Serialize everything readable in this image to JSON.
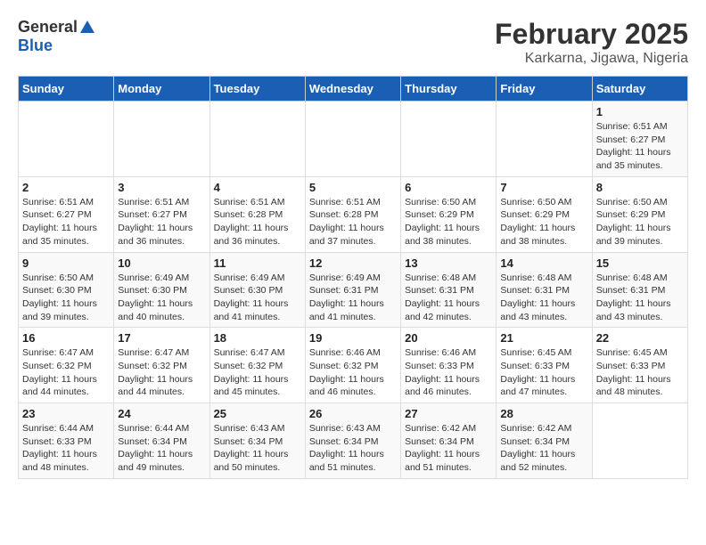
{
  "header": {
    "logo_general": "General",
    "logo_blue": "Blue",
    "title": "February 2025",
    "subtitle": "Karkarna, Jigawa, Nigeria"
  },
  "days_of_week": [
    "Sunday",
    "Monday",
    "Tuesday",
    "Wednesday",
    "Thursday",
    "Friday",
    "Saturday"
  ],
  "weeks": [
    [
      {
        "day": "",
        "info": ""
      },
      {
        "day": "",
        "info": ""
      },
      {
        "day": "",
        "info": ""
      },
      {
        "day": "",
        "info": ""
      },
      {
        "day": "",
        "info": ""
      },
      {
        "day": "",
        "info": ""
      },
      {
        "day": "1",
        "info": "Sunrise: 6:51 AM\nSunset: 6:27 PM\nDaylight: 11 hours\nand 35 minutes."
      }
    ],
    [
      {
        "day": "2",
        "info": "Sunrise: 6:51 AM\nSunset: 6:27 PM\nDaylight: 11 hours\nand 35 minutes."
      },
      {
        "day": "3",
        "info": "Sunrise: 6:51 AM\nSunset: 6:27 PM\nDaylight: 11 hours\nand 36 minutes."
      },
      {
        "day": "4",
        "info": "Sunrise: 6:51 AM\nSunset: 6:28 PM\nDaylight: 11 hours\nand 36 minutes."
      },
      {
        "day": "5",
        "info": "Sunrise: 6:51 AM\nSunset: 6:28 PM\nDaylight: 11 hours\nand 37 minutes."
      },
      {
        "day": "6",
        "info": "Sunrise: 6:50 AM\nSunset: 6:29 PM\nDaylight: 11 hours\nand 38 minutes."
      },
      {
        "day": "7",
        "info": "Sunrise: 6:50 AM\nSunset: 6:29 PM\nDaylight: 11 hours\nand 38 minutes."
      },
      {
        "day": "8",
        "info": "Sunrise: 6:50 AM\nSunset: 6:29 PM\nDaylight: 11 hours\nand 39 minutes."
      }
    ],
    [
      {
        "day": "9",
        "info": "Sunrise: 6:50 AM\nSunset: 6:30 PM\nDaylight: 11 hours\nand 39 minutes."
      },
      {
        "day": "10",
        "info": "Sunrise: 6:49 AM\nSunset: 6:30 PM\nDaylight: 11 hours\nand 40 minutes."
      },
      {
        "day": "11",
        "info": "Sunrise: 6:49 AM\nSunset: 6:30 PM\nDaylight: 11 hours\nand 41 minutes."
      },
      {
        "day": "12",
        "info": "Sunrise: 6:49 AM\nSunset: 6:31 PM\nDaylight: 11 hours\nand 41 minutes."
      },
      {
        "day": "13",
        "info": "Sunrise: 6:48 AM\nSunset: 6:31 PM\nDaylight: 11 hours\nand 42 minutes."
      },
      {
        "day": "14",
        "info": "Sunrise: 6:48 AM\nSunset: 6:31 PM\nDaylight: 11 hours\nand 43 minutes."
      },
      {
        "day": "15",
        "info": "Sunrise: 6:48 AM\nSunset: 6:31 PM\nDaylight: 11 hours\nand 43 minutes."
      }
    ],
    [
      {
        "day": "16",
        "info": "Sunrise: 6:47 AM\nSunset: 6:32 PM\nDaylight: 11 hours\nand 44 minutes."
      },
      {
        "day": "17",
        "info": "Sunrise: 6:47 AM\nSunset: 6:32 PM\nDaylight: 11 hours\nand 44 minutes."
      },
      {
        "day": "18",
        "info": "Sunrise: 6:47 AM\nSunset: 6:32 PM\nDaylight: 11 hours\nand 45 minutes."
      },
      {
        "day": "19",
        "info": "Sunrise: 6:46 AM\nSunset: 6:32 PM\nDaylight: 11 hours\nand 46 minutes."
      },
      {
        "day": "20",
        "info": "Sunrise: 6:46 AM\nSunset: 6:33 PM\nDaylight: 11 hours\nand 46 minutes."
      },
      {
        "day": "21",
        "info": "Sunrise: 6:45 AM\nSunset: 6:33 PM\nDaylight: 11 hours\nand 47 minutes."
      },
      {
        "day": "22",
        "info": "Sunrise: 6:45 AM\nSunset: 6:33 PM\nDaylight: 11 hours\nand 48 minutes."
      }
    ],
    [
      {
        "day": "23",
        "info": "Sunrise: 6:44 AM\nSunset: 6:33 PM\nDaylight: 11 hours\nand 48 minutes."
      },
      {
        "day": "24",
        "info": "Sunrise: 6:44 AM\nSunset: 6:34 PM\nDaylight: 11 hours\nand 49 minutes."
      },
      {
        "day": "25",
        "info": "Sunrise: 6:43 AM\nSunset: 6:34 PM\nDaylight: 11 hours\nand 50 minutes."
      },
      {
        "day": "26",
        "info": "Sunrise: 6:43 AM\nSunset: 6:34 PM\nDaylight: 11 hours\nand 51 minutes."
      },
      {
        "day": "27",
        "info": "Sunrise: 6:42 AM\nSunset: 6:34 PM\nDaylight: 11 hours\nand 51 minutes."
      },
      {
        "day": "28",
        "info": "Sunrise: 6:42 AM\nSunset: 6:34 PM\nDaylight: 11 hours\nand 52 minutes."
      },
      {
        "day": "",
        "info": ""
      }
    ]
  ]
}
